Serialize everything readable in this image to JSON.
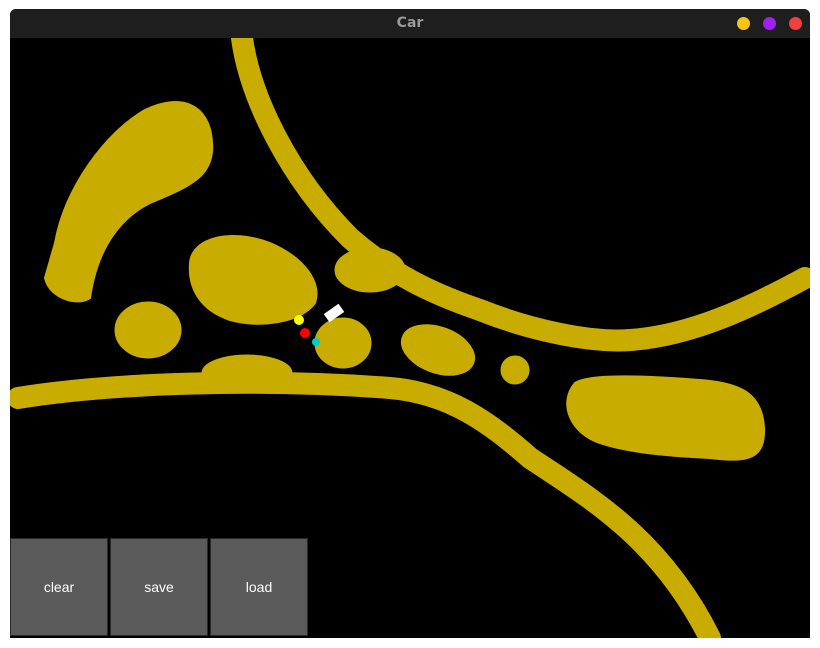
{
  "window": {
    "title": "Car",
    "controls": [
      {
        "name": "minimize-button",
        "color": "#f5c518"
      },
      {
        "name": "maximize-button",
        "color": "#a020f0"
      },
      {
        "name": "close-button",
        "color": "#f04040"
      }
    ]
  },
  "canvas": {
    "background": "#000000",
    "sand_color": "#c8ac00",
    "car_color": "#ffffff",
    "sensor_colors": [
      "#ffff00",
      "#ff0000",
      "#00cccc"
    ]
  },
  "buttons": {
    "clear_label": "clear",
    "save_label": "save",
    "load_label": "load"
  }
}
